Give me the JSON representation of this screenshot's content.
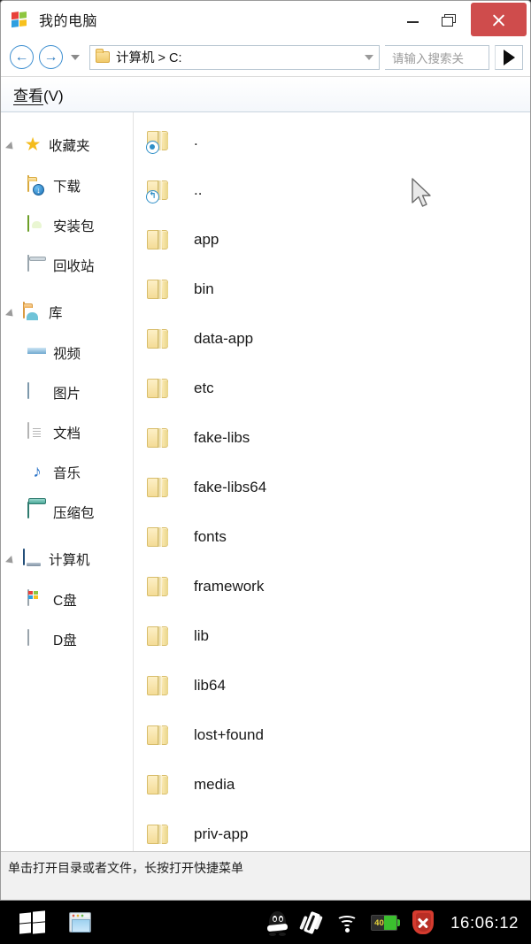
{
  "window": {
    "title": "我的电脑",
    "app_icon": "windows-flag-icon",
    "controls": {
      "minimize": "minimize-icon",
      "restore": "restore-icon",
      "close": "close-icon"
    }
  },
  "address_bar": {
    "back_glyph": "←",
    "forward_glyph": "→",
    "history_dropdown": "chevron-down-icon",
    "breadcrumb": "计算机 > C:",
    "breadcrumb_dropdown": "chevron-down-icon",
    "search_placeholder": "请输入搜索关",
    "go_glyph": "▶"
  },
  "menu": {
    "view_label_underlined": "查看",
    "view_label_rest": "(V)"
  },
  "sidebar": {
    "groups": [
      {
        "label": "收藏夹",
        "icon": "star-icon",
        "expanded": true,
        "items": [
          {
            "label": "下载",
            "icon": "downloads-folder-icon"
          },
          {
            "label": "安装包",
            "icon": "apk-package-icon"
          },
          {
            "label": "回收站",
            "icon": "recycle-bin-icon"
          }
        ]
      },
      {
        "label": "库",
        "icon": "library-folder-icon",
        "expanded": true,
        "items": [
          {
            "label": "视频",
            "icon": "film-strip-icon"
          },
          {
            "label": "图片",
            "icon": "picture-icon"
          },
          {
            "label": "文档",
            "icon": "document-icon"
          },
          {
            "label": "音乐",
            "icon": "music-note-icon"
          },
          {
            "label": "压缩包",
            "icon": "archive-stack-icon"
          }
        ]
      },
      {
        "label": "计算机",
        "icon": "computer-icon",
        "expanded": true,
        "items": [
          {
            "label": "C盘",
            "icon": "drive-c-icon"
          },
          {
            "label": "D盘",
            "icon": "drive-d-icon"
          }
        ]
      }
    ]
  },
  "file_list": {
    "items": [
      {
        "name": ".",
        "icon": "folder-icon",
        "badge": "current-dir-badge"
      },
      {
        "name": "..",
        "icon": "folder-icon",
        "badge": "parent-dir-badge"
      },
      {
        "name": "app",
        "icon": "folder-icon",
        "badge": ""
      },
      {
        "name": "bin",
        "icon": "folder-icon",
        "badge": ""
      },
      {
        "name": "data-app",
        "icon": "folder-icon",
        "badge": ""
      },
      {
        "name": "etc",
        "icon": "folder-icon",
        "badge": ""
      },
      {
        "name": "fake-libs",
        "icon": "folder-icon",
        "badge": ""
      },
      {
        "name": "fake-libs64",
        "icon": "folder-icon",
        "badge": ""
      },
      {
        "name": "fonts",
        "icon": "folder-icon",
        "badge": ""
      },
      {
        "name": "framework",
        "icon": "folder-icon",
        "badge": ""
      },
      {
        "name": "lib",
        "icon": "folder-icon",
        "badge": ""
      },
      {
        "name": "lib64",
        "icon": "folder-icon",
        "badge": ""
      },
      {
        "name": "lost+found",
        "icon": "folder-icon",
        "badge": ""
      },
      {
        "name": "media",
        "icon": "folder-icon",
        "badge": ""
      },
      {
        "name": "priv-app",
        "icon": "folder-icon",
        "badge": ""
      }
    ]
  },
  "status_bar": {
    "text": "单击打开目录或者文件，长按打开快捷菜单"
  },
  "taskbar": {
    "start_icon": "windows-start-icon",
    "explorer_icon": "file-explorer-icon",
    "tray": [
      {
        "icon": "qq-penguin-icon"
      },
      {
        "icon": "shake-vibrate-icon"
      },
      {
        "icon": "wifi-icon"
      },
      {
        "icon": "battery-icon",
        "value": "40"
      },
      {
        "icon": "security-shield-icon"
      }
    ],
    "clock": "16:06:12"
  },
  "colors": {
    "close_button": "#cf4c4c",
    "accent_blue": "#3c8ed0",
    "battery_green": "#3bbf2e",
    "shield_red": "#d43b2f",
    "taskbar_bg": "#000000"
  }
}
